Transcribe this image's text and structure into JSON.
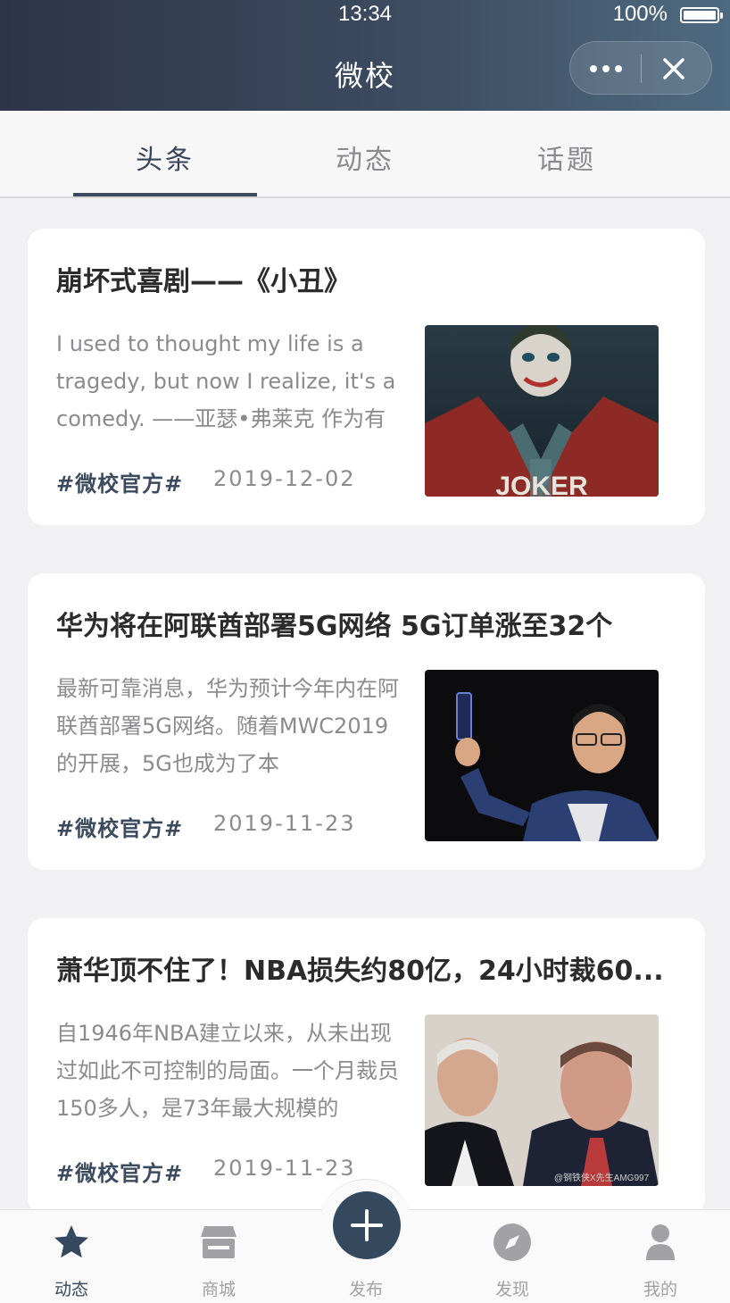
{
  "status": {
    "time": "13:34",
    "battery": "100%"
  },
  "nav": {
    "title": "微校"
  },
  "tabs": [
    {
      "label": "头条"
    },
    {
      "label": "动态"
    },
    {
      "label": "话题"
    }
  ],
  "articles": [
    {
      "title": "崩坏式喜剧——《小丑》",
      "summary": "I used to thought my life is a tragedy, but now I realize, it's a comedy. ——亚瑟•弗莱克 作为有",
      "tag": "#微校官方#",
      "date": "2019-12-02",
      "thumb_caption": "JOKER"
    },
    {
      "title": "华为将在阿联酋部署5G网络 5G订单涨至32个",
      "summary": "最新可靠消息，华为预计今年内在阿联酋部署5G网络。随着MWC2019的开展，5G也成为了本",
      "tag": "#微校官方#",
      "date": "2019-11-23"
    },
    {
      "title": "萧华顶不住了！NBA损失约80亿，24小时裁60...",
      "summary": "自1946年NBA建立以来，从未出现过如此不可控制的局面。一个月裁员150多人，是73年最大规模的",
      "tag": "#微校官方#",
      "date": "2019-11-23",
      "thumb_caption": "@钢铁侠X先生AMG997"
    }
  ],
  "tabbar": [
    {
      "label": "动态",
      "icon": "star-icon"
    },
    {
      "label": "商城",
      "icon": "store-icon"
    },
    {
      "label": "发布",
      "icon": "plus-icon"
    },
    {
      "label": "发现",
      "icon": "compass-icon"
    },
    {
      "label": "我的",
      "icon": "user-icon"
    }
  ],
  "colors": {
    "accent": "#34495e",
    "background": "#f1f1f3",
    "inactive": "#a2a2a6"
  }
}
